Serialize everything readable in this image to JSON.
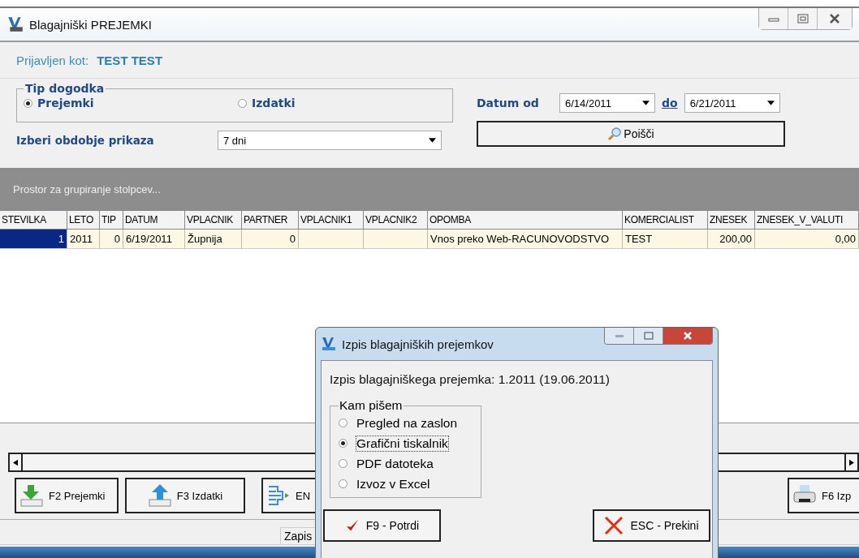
{
  "window": {
    "title": "Blagajniški PREJEMKI"
  },
  "login": {
    "label": "Prijavljen kot:",
    "user": "TEST TEST"
  },
  "event_type": {
    "legend": "Tip dogodka",
    "options": [
      {
        "label": "Prejemki",
        "selected": true
      },
      {
        "label": "Izdatki",
        "selected": false
      }
    ]
  },
  "date_from": {
    "label": "Datum od",
    "value": "6/14/2011"
  },
  "date_to": {
    "label": "do",
    "value": "6/21/2011"
  },
  "period": {
    "label": "Izberi obdobje prikaza",
    "value": "7 dni"
  },
  "search_button": "Poišči",
  "group_panel": "Prostor za grupiranje stolpcev...",
  "table": {
    "columns": [
      "STEVILKA",
      "LETO",
      "TIP",
      "DATUM",
      "VPLACNIK",
      "PARTNER",
      "VPLACNIK1",
      "VPLACNIK2",
      "OPOMBA",
      "KOMERCIALIST",
      "ZNESEK",
      "ZNESEK_V_VALUTI"
    ],
    "rows": [
      {
        "selected": true,
        "cells": [
          "1",
          "2011",
          "0",
          "6/19/2011",
          "Župnija",
          "0",
          null,
          null,
          "Vnos preko Web-RACUNOVODSTVO",
          "TEST",
          "200,00",
          "0,00"
        ]
      }
    ]
  },
  "buttons": [
    {
      "kind": "in",
      "label": "F2 Prejemki"
    },
    {
      "kind": "out",
      "label": "F3 Izdatki"
    },
    {
      "kind": "enter",
      "label": "EN"
    }
  ],
  "print_button": "F6 Izp",
  "status_bar": {
    "text": "Zapis"
  },
  "dialog": {
    "title": "Izpis blagajniških prejemkov",
    "message": "Izpis blagajniškega prejemka: 1.2011 (19.06.2011)",
    "legend": "Kam pišem",
    "options": [
      {
        "label": "Pregled na zaslon",
        "selected": false
      },
      {
        "label": "Grafični tiskalnik",
        "selected": true
      },
      {
        "label": "PDF datoteka",
        "selected": false
      },
      {
        "label": "Izvoz v Excel",
        "selected": false
      }
    ],
    "confirm": "F9 - Potrdi",
    "cancel": "ESC - Prekini"
  }
}
